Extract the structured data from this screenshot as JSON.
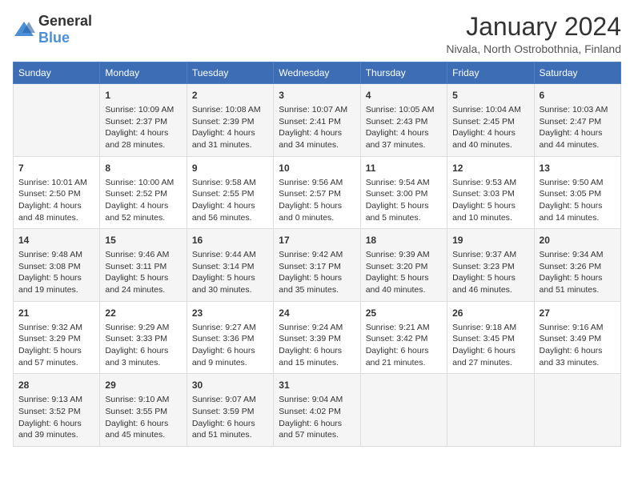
{
  "logo": {
    "text_general": "General",
    "text_blue": "Blue"
  },
  "title": "January 2024",
  "subtitle": "Nivala, North Ostrobothnia, Finland",
  "weekdays": [
    "Sunday",
    "Monday",
    "Tuesday",
    "Wednesday",
    "Thursday",
    "Friday",
    "Saturday"
  ],
  "weeks": [
    [
      {
        "day": "",
        "info": ""
      },
      {
        "day": "1",
        "info": "Sunrise: 10:09 AM\nSunset: 2:37 PM\nDaylight: 4 hours\nand 28 minutes."
      },
      {
        "day": "2",
        "info": "Sunrise: 10:08 AM\nSunset: 2:39 PM\nDaylight: 4 hours\nand 31 minutes."
      },
      {
        "day": "3",
        "info": "Sunrise: 10:07 AM\nSunset: 2:41 PM\nDaylight: 4 hours\nand 34 minutes."
      },
      {
        "day": "4",
        "info": "Sunrise: 10:05 AM\nSunset: 2:43 PM\nDaylight: 4 hours\nand 37 minutes."
      },
      {
        "day": "5",
        "info": "Sunrise: 10:04 AM\nSunset: 2:45 PM\nDaylight: 4 hours\nand 40 minutes."
      },
      {
        "day": "6",
        "info": "Sunrise: 10:03 AM\nSunset: 2:47 PM\nDaylight: 4 hours\nand 44 minutes."
      }
    ],
    [
      {
        "day": "7",
        "info": "Sunrise: 10:01 AM\nSunset: 2:50 PM\nDaylight: 4 hours\nand 48 minutes."
      },
      {
        "day": "8",
        "info": "Sunrise: 10:00 AM\nSunset: 2:52 PM\nDaylight: 4 hours\nand 52 minutes."
      },
      {
        "day": "9",
        "info": "Sunrise: 9:58 AM\nSunset: 2:55 PM\nDaylight: 4 hours\nand 56 minutes."
      },
      {
        "day": "10",
        "info": "Sunrise: 9:56 AM\nSunset: 2:57 PM\nDaylight: 5 hours\nand 0 minutes."
      },
      {
        "day": "11",
        "info": "Sunrise: 9:54 AM\nSunset: 3:00 PM\nDaylight: 5 hours\nand 5 minutes."
      },
      {
        "day": "12",
        "info": "Sunrise: 9:53 AM\nSunset: 3:03 PM\nDaylight: 5 hours\nand 10 minutes."
      },
      {
        "day": "13",
        "info": "Sunrise: 9:50 AM\nSunset: 3:05 PM\nDaylight: 5 hours\nand 14 minutes."
      }
    ],
    [
      {
        "day": "14",
        "info": "Sunrise: 9:48 AM\nSunset: 3:08 PM\nDaylight: 5 hours\nand 19 minutes."
      },
      {
        "day": "15",
        "info": "Sunrise: 9:46 AM\nSunset: 3:11 PM\nDaylight: 5 hours\nand 24 minutes."
      },
      {
        "day": "16",
        "info": "Sunrise: 9:44 AM\nSunset: 3:14 PM\nDaylight: 5 hours\nand 30 minutes."
      },
      {
        "day": "17",
        "info": "Sunrise: 9:42 AM\nSunset: 3:17 PM\nDaylight: 5 hours\nand 35 minutes."
      },
      {
        "day": "18",
        "info": "Sunrise: 9:39 AM\nSunset: 3:20 PM\nDaylight: 5 hours\nand 40 minutes."
      },
      {
        "day": "19",
        "info": "Sunrise: 9:37 AM\nSunset: 3:23 PM\nDaylight: 5 hours\nand 46 minutes."
      },
      {
        "day": "20",
        "info": "Sunrise: 9:34 AM\nSunset: 3:26 PM\nDaylight: 5 hours\nand 51 minutes."
      }
    ],
    [
      {
        "day": "21",
        "info": "Sunrise: 9:32 AM\nSunset: 3:29 PM\nDaylight: 5 hours\nand 57 minutes."
      },
      {
        "day": "22",
        "info": "Sunrise: 9:29 AM\nSunset: 3:33 PM\nDaylight: 6 hours\nand 3 minutes."
      },
      {
        "day": "23",
        "info": "Sunrise: 9:27 AM\nSunset: 3:36 PM\nDaylight: 6 hours\nand 9 minutes."
      },
      {
        "day": "24",
        "info": "Sunrise: 9:24 AM\nSunset: 3:39 PM\nDaylight: 6 hours\nand 15 minutes."
      },
      {
        "day": "25",
        "info": "Sunrise: 9:21 AM\nSunset: 3:42 PM\nDaylight: 6 hours\nand 21 minutes."
      },
      {
        "day": "26",
        "info": "Sunrise: 9:18 AM\nSunset: 3:45 PM\nDaylight: 6 hours\nand 27 minutes."
      },
      {
        "day": "27",
        "info": "Sunrise: 9:16 AM\nSunset: 3:49 PM\nDaylight: 6 hours\nand 33 minutes."
      }
    ],
    [
      {
        "day": "28",
        "info": "Sunrise: 9:13 AM\nSunset: 3:52 PM\nDaylight: 6 hours\nand 39 minutes."
      },
      {
        "day": "29",
        "info": "Sunrise: 9:10 AM\nSunset: 3:55 PM\nDaylight: 6 hours\nand 45 minutes."
      },
      {
        "day": "30",
        "info": "Sunrise: 9:07 AM\nSunset: 3:59 PM\nDaylight: 6 hours\nand 51 minutes."
      },
      {
        "day": "31",
        "info": "Sunrise: 9:04 AM\nSunset: 4:02 PM\nDaylight: 6 hours\nand 57 minutes."
      },
      {
        "day": "",
        "info": ""
      },
      {
        "day": "",
        "info": ""
      },
      {
        "day": "",
        "info": ""
      }
    ]
  ]
}
